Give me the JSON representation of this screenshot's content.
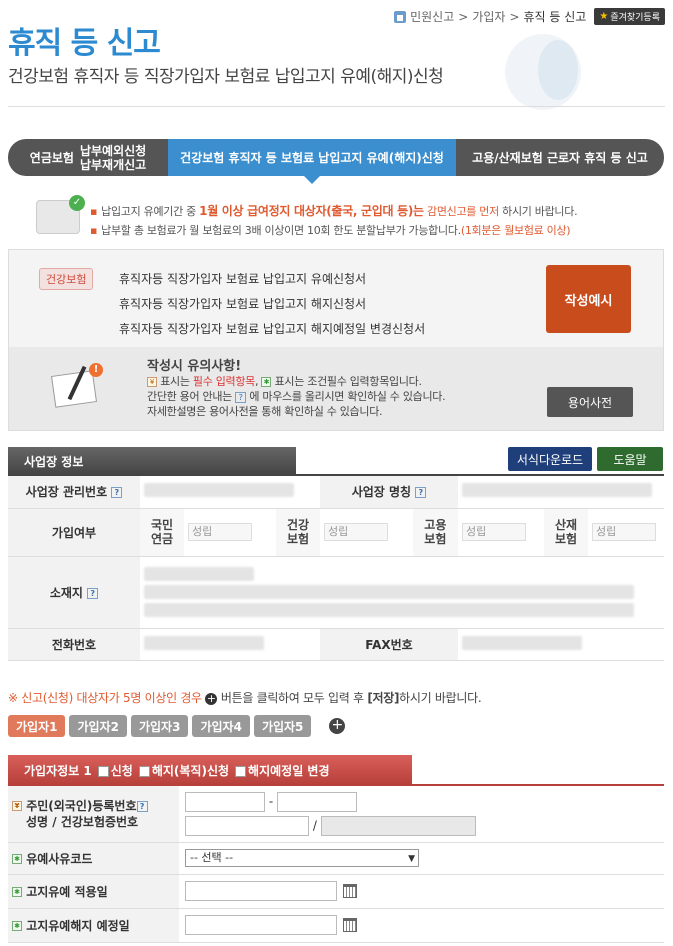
{
  "breadcrumb": {
    "items": [
      "민원신고",
      "가입자"
    ],
    "current": "휴직 등 신고",
    "favorite": "즐겨찾기등록"
  },
  "page": {
    "title": "휴직 등 신고",
    "subtitle": "건강보험 휴직자 등 직장가입자 보험료 납입고지 유예(해지)신청"
  },
  "tabs": {
    "tab1_a": "연금보험",
    "tab1_b": "납부예외신청",
    "tab1_c": "납부재개신고",
    "tab2": "건강보험 휴직자 등 보험료 납입고지 유예(해지)신청",
    "tab3": "고용/산재보험 근로자 휴직 등 신고"
  },
  "notice": {
    "line1_a": "납입고지 유예기간 중",
    "line1_hl": "1월 이상 급여정지 대상자(출국, 군입대 등)는",
    "line1_hl2": "감면신고를 먼저",
    "line1_b": "하시기 바랍니다.",
    "line2_a": "납부할 총 보험료가 월 보험료의 3배 이상이면 10회 한도 분할납부가 가능합니다.",
    "line2_hl": "(1회분은 월보험료 이상)"
  },
  "forms": {
    "tag": "건강보험",
    "items": [
      "휴직자등 직장가입자 보험료 납입고지 유예신청서",
      "휴직자등 직장가입자 보험료 납입고지 해지신청서",
      "휴직자등 직장가입자 보험료 납입고지 해지예정일 변경신청서"
    ],
    "example_button": "작성예시"
  },
  "caution": {
    "title": "작성시 유의사항!",
    "l1_a": "표시는",
    "l1_req": "필수 입력항목",
    "l1_b": "표시는 조건필수 입력항목입니다.",
    "l2_a": "간단한 용어 안내는",
    "l2_b": "에 마우스를 올리시면 확인하실 수 있습니다.",
    "l3": "자세한설명은 용어사전을 통해 확인하실 수 있습니다.",
    "dict_button": "용어사전"
  },
  "business": {
    "section_title": "사업장 정보",
    "download_button": "서식다운로드",
    "help_button": "도움말",
    "mgmt_no_label": "사업장 관리번호",
    "name_label": "사업장 명칭",
    "join_label": "가입여부",
    "ins": [
      {
        "l1": "국민",
        "l2": "연금",
        "status": "성립"
      },
      {
        "l1": "건강",
        "l2": "보험",
        "status": "성립"
      },
      {
        "l1": "고용",
        "l2": "보험",
        "status": "성립"
      },
      {
        "l1": "산재",
        "l2": "보험",
        "status": "성립"
      }
    ],
    "addr_label": "소재지",
    "phone_label": "전화번호",
    "fax_label": "FAX번호"
  },
  "info": {
    "prefix": "※",
    "hl": "신고(신청) 대상자가 5명 이상인 경우",
    "mid": "버튼을 클릭하여 모두 입력 후",
    "save": "[저장]",
    "end": "하시기 바랍니다."
  },
  "subscriber_tabs": [
    "가입자1",
    "가입자2",
    "가입자3",
    "가입자4",
    "가입자5"
  ],
  "subscriber": {
    "header": "가입자정보 1",
    "opt1": "신청",
    "opt2": "해지(복직)신청",
    "opt3": "해지예정일 변경",
    "rrn_label": "주민(외국인)등록번호",
    "name_label": "성명 / 건강보험증번호",
    "reason_label": "유예사유코드",
    "reason_select": "-- 선택 --",
    "apply_date_label": "고지유예 적용일",
    "cancel_date_label": "고지유예해지 예정일"
  }
}
